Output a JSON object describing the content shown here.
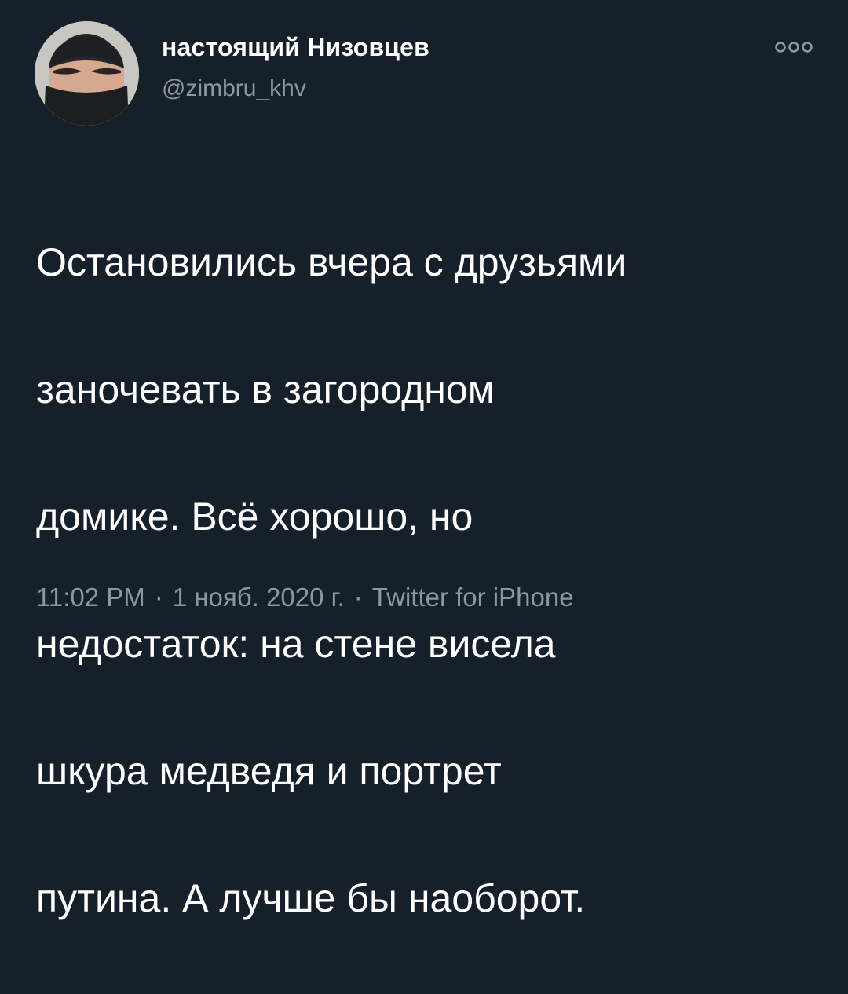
{
  "author": {
    "display_name": "настоящий Низовцев",
    "handle": "@zimbru_khv",
    "avatar_icon": "balaclava-avatar"
  },
  "more_button": {
    "icon": "more-options-icon"
  },
  "tweet": {
    "text_lines": [
      "Остановились вчера с друзьями",
      "заночевать в загородном",
      "домике. Всё хорошо, но",
      "недостаток: на стене висела",
      "шкура медведя и портрет",
      "путина. А лучше бы наоборот."
    ]
  },
  "meta": {
    "time": "11:02 PM",
    "separator": "·",
    "date": "1 нояб. 2020 г.",
    "source": "Twitter for iPhone"
  },
  "colors": {
    "background": "#15202b",
    "primary_text": "#ffffff",
    "secondary_text": "#8899a6"
  }
}
